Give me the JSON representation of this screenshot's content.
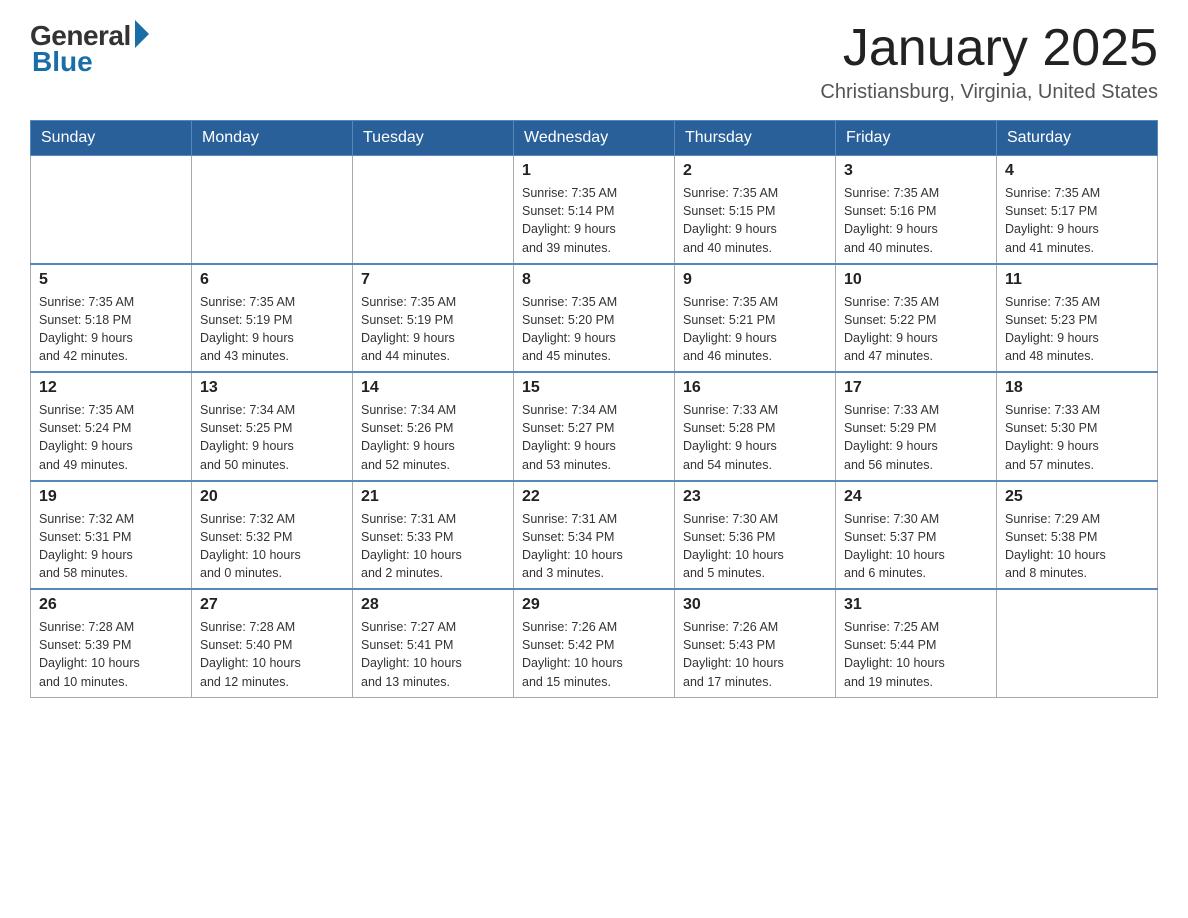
{
  "header": {
    "logo_general": "General",
    "logo_blue": "Blue",
    "title": "January 2025",
    "location": "Christiansburg, Virginia, United States"
  },
  "days_of_week": [
    "Sunday",
    "Monday",
    "Tuesday",
    "Wednesday",
    "Thursday",
    "Friday",
    "Saturday"
  ],
  "weeks": [
    [
      {
        "day": "",
        "info": ""
      },
      {
        "day": "",
        "info": ""
      },
      {
        "day": "",
        "info": ""
      },
      {
        "day": "1",
        "info": "Sunrise: 7:35 AM\nSunset: 5:14 PM\nDaylight: 9 hours\nand 39 minutes."
      },
      {
        "day": "2",
        "info": "Sunrise: 7:35 AM\nSunset: 5:15 PM\nDaylight: 9 hours\nand 40 minutes."
      },
      {
        "day": "3",
        "info": "Sunrise: 7:35 AM\nSunset: 5:16 PM\nDaylight: 9 hours\nand 40 minutes."
      },
      {
        "day": "4",
        "info": "Sunrise: 7:35 AM\nSunset: 5:17 PM\nDaylight: 9 hours\nand 41 minutes."
      }
    ],
    [
      {
        "day": "5",
        "info": "Sunrise: 7:35 AM\nSunset: 5:18 PM\nDaylight: 9 hours\nand 42 minutes."
      },
      {
        "day": "6",
        "info": "Sunrise: 7:35 AM\nSunset: 5:19 PM\nDaylight: 9 hours\nand 43 minutes."
      },
      {
        "day": "7",
        "info": "Sunrise: 7:35 AM\nSunset: 5:19 PM\nDaylight: 9 hours\nand 44 minutes."
      },
      {
        "day": "8",
        "info": "Sunrise: 7:35 AM\nSunset: 5:20 PM\nDaylight: 9 hours\nand 45 minutes."
      },
      {
        "day": "9",
        "info": "Sunrise: 7:35 AM\nSunset: 5:21 PM\nDaylight: 9 hours\nand 46 minutes."
      },
      {
        "day": "10",
        "info": "Sunrise: 7:35 AM\nSunset: 5:22 PM\nDaylight: 9 hours\nand 47 minutes."
      },
      {
        "day": "11",
        "info": "Sunrise: 7:35 AM\nSunset: 5:23 PM\nDaylight: 9 hours\nand 48 minutes."
      }
    ],
    [
      {
        "day": "12",
        "info": "Sunrise: 7:35 AM\nSunset: 5:24 PM\nDaylight: 9 hours\nand 49 minutes."
      },
      {
        "day": "13",
        "info": "Sunrise: 7:34 AM\nSunset: 5:25 PM\nDaylight: 9 hours\nand 50 minutes."
      },
      {
        "day": "14",
        "info": "Sunrise: 7:34 AM\nSunset: 5:26 PM\nDaylight: 9 hours\nand 52 minutes."
      },
      {
        "day": "15",
        "info": "Sunrise: 7:34 AM\nSunset: 5:27 PM\nDaylight: 9 hours\nand 53 minutes."
      },
      {
        "day": "16",
        "info": "Sunrise: 7:33 AM\nSunset: 5:28 PM\nDaylight: 9 hours\nand 54 minutes."
      },
      {
        "day": "17",
        "info": "Sunrise: 7:33 AM\nSunset: 5:29 PM\nDaylight: 9 hours\nand 56 minutes."
      },
      {
        "day": "18",
        "info": "Sunrise: 7:33 AM\nSunset: 5:30 PM\nDaylight: 9 hours\nand 57 minutes."
      }
    ],
    [
      {
        "day": "19",
        "info": "Sunrise: 7:32 AM\nSunset: 5:31 PM\nDaylight: 9 hours\nand 58 minutes."
      },
      {
        "day": "20",
        "info": "Sunrise: 7:32 AM\nSunset: 5:32 PM\nDaylight: 10 hours\nand 0 minutes."
      },
      {
        "day": "21",
        "info": "Sunrise: 7:31 AM\nSunset: 5:33 PM\nDaylight: 10 hours\nand 2 minutes."
      },
      {
        "day": "22",
        "info": "Sunrise: 7:31 AM\nSunset: 5:34 PM\nDaylight: 10 hours\nand 3 minutes."
      },
      {
        "day": "23",
        "info": "Sunrise: 7:30 AM\nSunset: 5:36 PM\nDaylight: 10 hours\nand 5 minutes."
      },
      {
        "day": "24",
        "info": "Sunrise: 7:30 AM\nSunset: 5:37 PM\nDaylight: 10 hours\nand 6 minutes."
      },
      {
        "day": "25",
        "info": "Sunrise: 7:29 AM\nSunset: 5:38 PM\nDaylight: 10 hours\nand 8 minutes."
      }
    ],
    [
      {
        "day": "26",
        "info": "Sunrise: 7:28 AM\nSunset: 5:39 PM\nDaylight: 10 hours\nand 10 minutes."
      },
      {
        "day": "27",
        "info": "Sunrise: 7:28 AM\nSunset: 5:40 PM\nDaylight: 10 hours\nand 12 minutes."
      },
      {
        "day": "28",
        "info": "Sunrise: 7:27 AM\nSunset: 5:41 PM\nDaylight: 10 hours\nand 13 minutes."
      },
      {
        "day": "29",
        "info": "Sunrise: 7:26 AM\nSunset: 5:42 PM\nDaylight: 10 hours\nand 15 minutes."
      },
      {
        "day": "30",
        "info": "Sunrise: 7:26 AM\nSunset: 5:43 PM\nDaylight: 10 hours\nand 17 minutes."
      },
      {
        "day": "31",
        "info": "Sunrise: 7:25 AM\nSunset: 5:44 PM\nDaylight: 10 hours\nand 19 minutes."
      },
      {
        "day": "",
        "info": ""
      }
    ]
  ]
}
